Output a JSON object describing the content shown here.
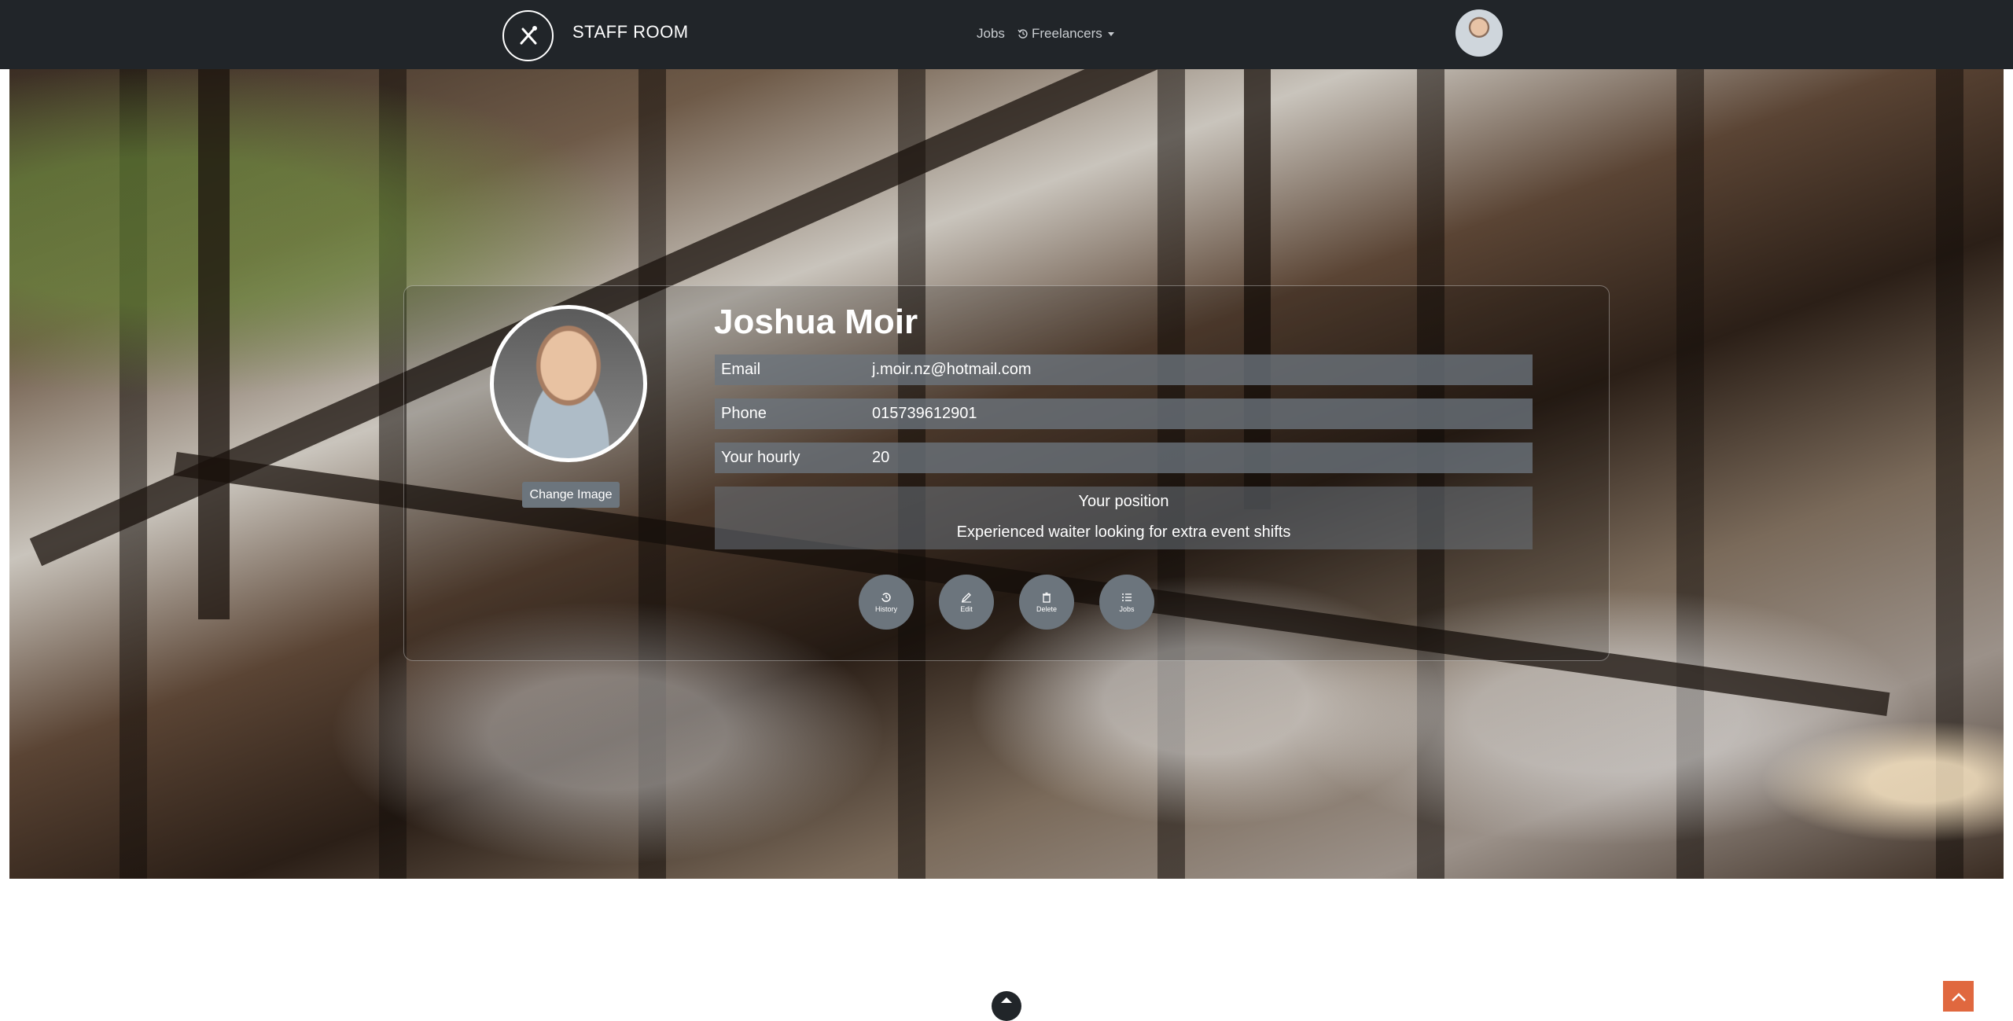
{
  "navbar": {
    "brand": "STAFF ROOM",
    "links": {
      "jobs": "Jobs",
      "freelancers": "Freelancers"
    },
    "logo_icon": "crossed-utensils-icon",
    "freelancers_icon": "history-icon",
    "avatar_icon": "user-avatar"
  },
  "profile": {
    "name": "Joshua Moir",
    "change_image_label": "Change Image",
    "fields": {
      "email": {
        "label": "Email",
        "value": "j.moir.nz@hotmail.com"
      },
      "phone": {
        "label": "Phone",
        "value": "015739612901"
      },
      "hourly": {
        "label": "Your hourly",
        "value": "20"
      }
    },
    "position": {
      "title": "Your position",
      "text": "Experienced waiter looking for extra event shifts"
    }
  },
  "actions": {
    "history": "History",
    "edit": "Edit",
    "delete": "Delete",
    "jobs": "Jobs"
  },
  "colors": {
    "navbar": "#212529",
    "button_gray": "#6c757d",
    "scroll_top": "#e0683f"
  }
}
